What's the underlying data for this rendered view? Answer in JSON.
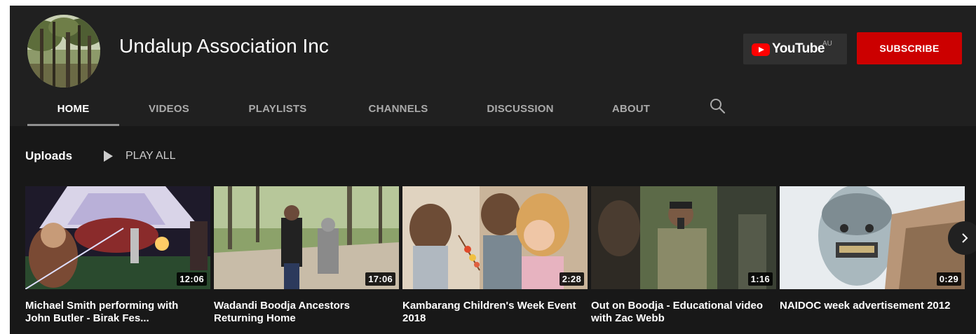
{
  "channel": {
    "name": "Undalup Association Inc",
    "avatar_icon": "channel-avatar-forest"
  },
  "youtube_badge": {
    "logo_icon": "youtube-play-logo-icon",
    "wordmark": "YouTube",
    "region": "AU"
  },
  "subscribe_label": "SUBSCRIBE",
  "tabs": [
    {
      "label": "HOME",
      "active": true
    },
    {
      "label": "VIDEOS",
      "active": false
    },
    {
      "label": "PLAYLISTS",
      "active": false
    },
    {
      "label": "CHANNELS",
      "active": false
    },
    {
      "label": "DISCUSSION",
      "active": false
    },
    {
      "label": "ABOUT",
      "active": false
    }
  ],
  "search_icon": "search-icon",
  "uploads": {
    "title": "Uploads",
    "play_all_label": "PLAY ALL",
    "videos": [
      {
        "title": "Michael Smith performing with John Butler - Birak Fes...",
        "duration": "12:06"
      },
      {
        "title": "Wadandi Boodja Ancestors Returning Home",
        "duration": "17:06"
      },
      {
        "title": "Kambarang Children's Week Event 2018",
        "duration": "2:28"
      },
      {
        "title": "Out on Boodja - Educational video with Zac Webb",
        "duration": "1:16"
      },
      {
        "title": "NAIDOC week advertisement 2012",
        "duration": "0:29"
      }
    ]
  },
  "next_arrow_icon": "chevron-right-icon",
  "colors": {
    "background": "#181818",
    "header": "#202020",
    "subscribe": "#cc0000",
    "youtube_red": "#ff0000"
  }
}
